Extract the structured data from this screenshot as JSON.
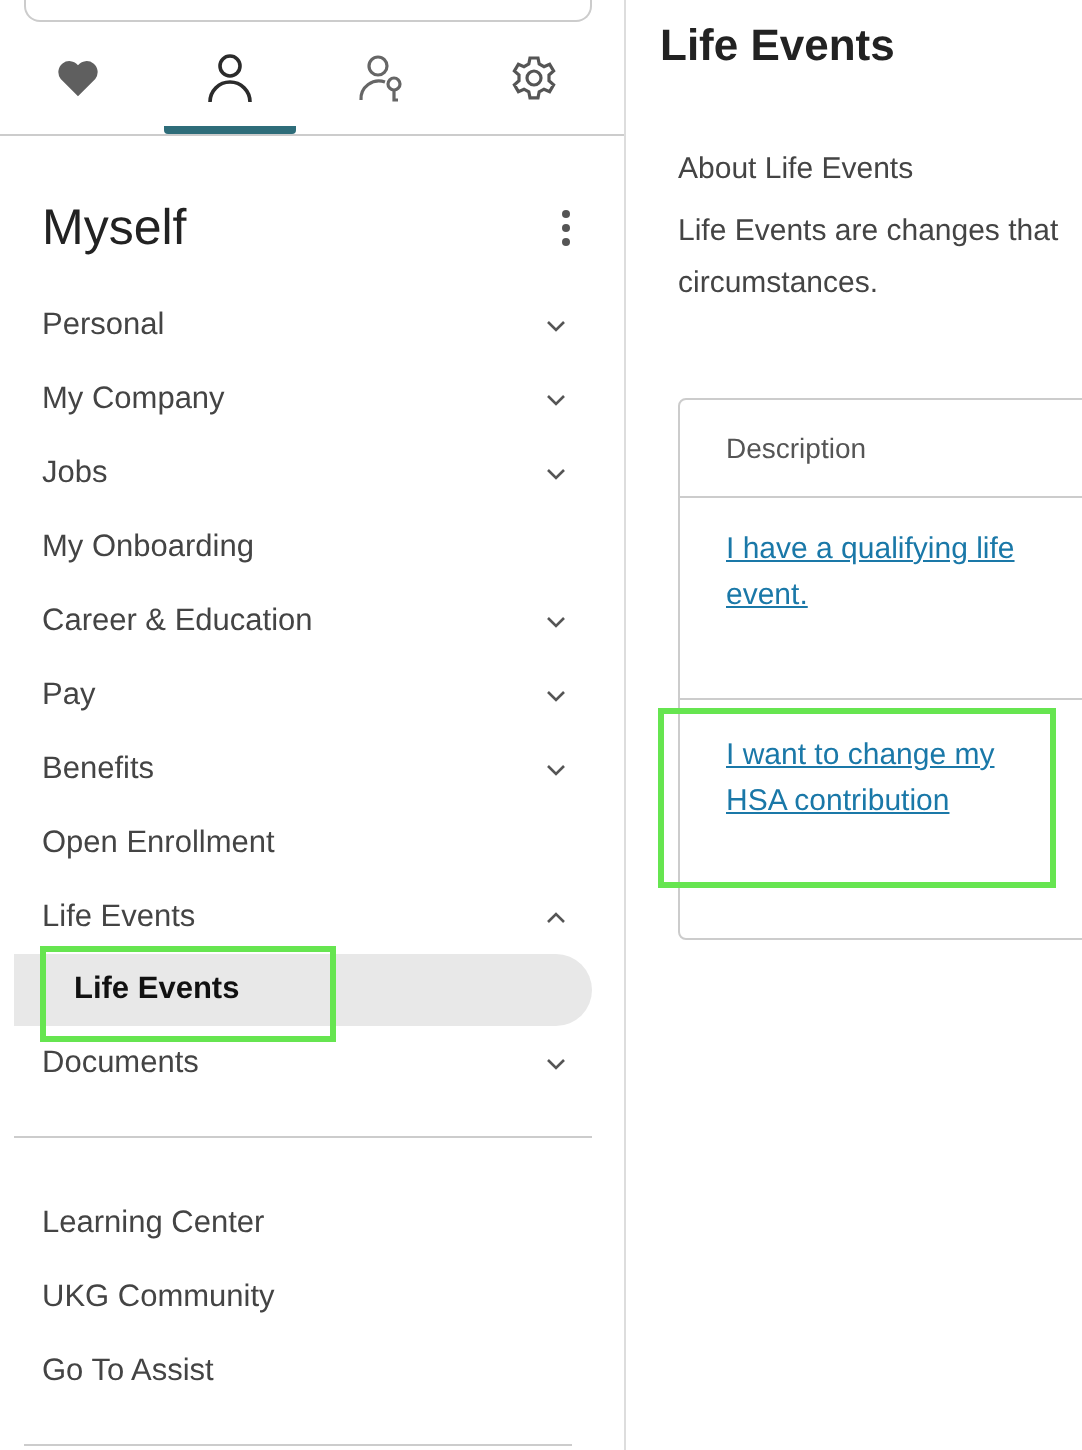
{
  "tabs": [
    {
      "kind": "heart",
      "selected": false
    },
    {
      "kind": "person",
      "selected": true
    },
    {
      "kind": "person-key",
      "selected": false
    },
    {
      "kind": "gear",
      "selected": false
    }
  ],
  "sidebar": {
    "title": "Myself",
    "items": [
      {
        "label": "Personal",
        "kind": "group",
        "expanded": false
      },
      {
        "label": "My Company",
        "kind": "group",
        "expanded": false
      },
      {
        "label": "Jobs",
        "kind": "group",
        "expanded": false
      },
      {
        "label": "My Onboarding",
        "kind": "link"
      },
      {
        "label": "Career & Education",
        "kind": "group",
        "expanded": false
      },
      {
        "label": "Pay",
        "kind": "group",
        "expanded": false
      },
      {
        "label": "Benefits",
        "kind": "group",
        "expanded": false
      },
      {
        "label": "Open Enrollment",
        "kind": "link"
      },
      {
        "label": "Life Events",
        "kind": "group",
        "expanded": true,
        "children": [
          {
            "label": "Life Events",
            "selected": true,
            "highlighted": true
          }
        ]
      },
      {
        "label": "Documents",
        "kind": "group",
        "expanded": false
      }
    ],
    "footer_links": [
      "Learning Center",
      "UKG Community",
      "Go To Assist"
    ]
  },
  "main": {
    "title": "Life Events",
    "subtitle": "About Life Events",
    "description_lines": [
      "Life Events are changes that",
      "circumstances."
    ],
    "table": {
      "columns": [
        "Description"
      ],
      "rows": [
        {
          "link": "I have a qualifying life event.",
          "highlighted": false
        },
        {
          "link": "I want to change my HSA contribution",
          "highlighted": true
        }
      ]
    }
  }
}
